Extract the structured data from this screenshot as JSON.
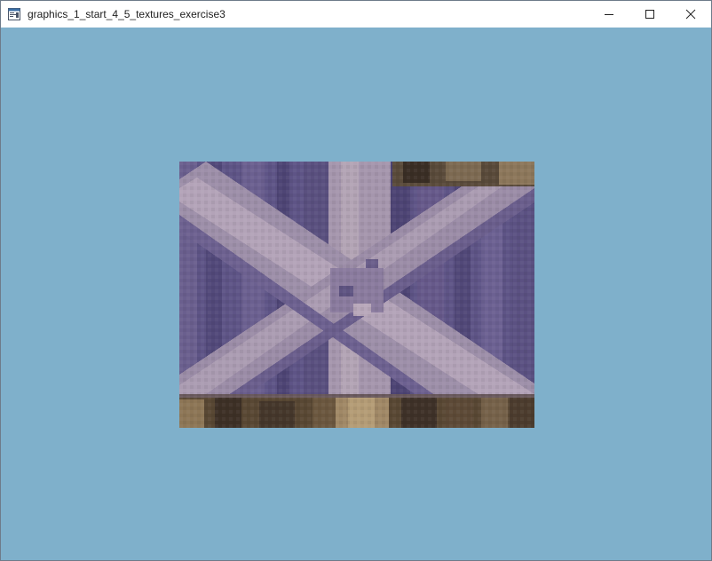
{
  "window": {
    "title": "graphics_1_start_4_5_textures_exercise3",
    "controls": {
      "minimize_icon": "minimize-icon",
      "maximize_icon": "maximize-icon",
      "close_icon": "close-icon"
    }
  },
  "scene": {
    "clear_color": "#7fb0cb",
    "texture": {
      "description_colors": {
        "wood_purple": "#5e5486",
        "wood_light": "#a697ad",
        "plank_dark": "#3d3026",
        "plank_tan": "#9c8462"
      }
    }
  }
}
